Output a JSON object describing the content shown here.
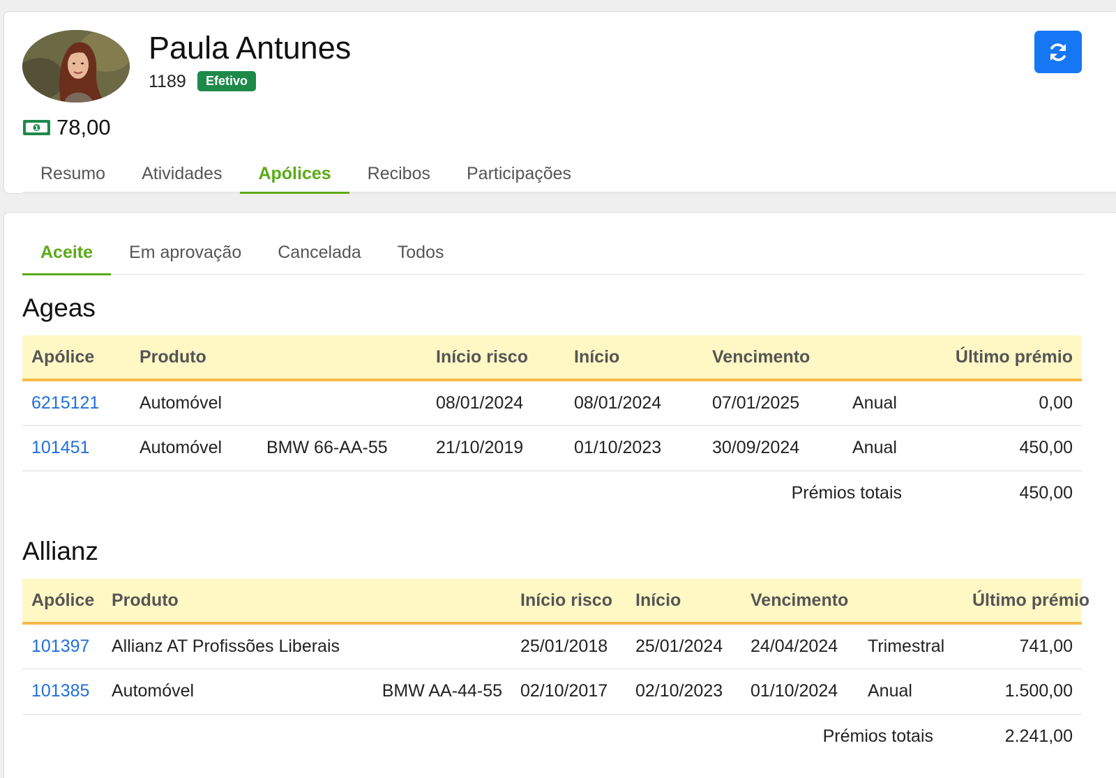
{
  "client": {
    "name": "Paula Antunes",
    "id": "1189",
    "status": "Efetivo",
    "balance": "78,00"
  },
  "main_tabs": [
    {
      "label": "Resumo",
      "active": false
    },
    {
      "label": "Atividades",
      "active": false
    },
    {
      "label": "Apólices",
      "active": true
    },
    {
      "label": "Recibos",
      "active": false
    },
    {
      "label": "Participações",
      "active": false
    }
  ],
  "sub_tabs": [
    {
      "label": "Aceite",
      "active": true
    },
    {
      "label": "Em aprovação",
      "active": false
    },
    {
      "label": "Cancelada",
      "active": false
    },
    {
      "label": "Todos",
      "active": false
    }
  ],
  "columns": {
    "policy": "Apólice",
    "product": "Produto",
    "risk_start": "Início risco",
    "start": "Início",
    "due": "Vencimento",
    "last_premium": "Último prémio"
  },
  "total_label": "Prémios totais",
  "groups": [
    {
      "insurer": "Ageas",
      "rows": [
        {
          "policy": "6215121",
          "product": "Automóvel",
          "object": "",
          "risk_start": "08/01/2024",
          "start": "08/01/2024",
          "due": "07/01/2025",
          "frequency": "Anual",
          "premium": "0,00"
        },
        {
          "policy": "101451",
          "product": "Automóvel",
          "object": "BMW 66-AA-55",
          "risk_start": "21/10/2019",
          "start": "01/10/2023",
          "due": "30/09/2024",
          "frequency": "Anual",
          "premium": "450,00"
        }
      ],
      "total": "450,00"
    },
    {
      "insurer": "Allianz",
      "rows": [
        {
          "policy": "101397",
          "product": "Allianz AT Profissões Liberais",
          "object": "",
          "risk_start": "25/01/2018",
          "start": "25/01/2024",
          "due": "24/04/2024",
          "frequency": "Trimestral",
          "premium": "741,00"
        },
        {
          "policy": "101385",
          "product": "Automóvel",
          "object": "BMW AA-44-55",
          "risk_start": "02/10/2017",
          "start": "02/10/2023",
          "due": "01/10/2024",
          "frequency": "Anual",
          "premium": "1.500,00"
        }
      ],
      "total": "2.241,00"
    }
  ],
  "icons": {
    "refresh": "refresh-icon",
    "money": "money-icon"
  },
  "colors": {
    "accent_green": "#5aaa16",
    "badge_green": "#1e8a4a",
    "link_blue": "#1f6fdc",
    "button_blue": "#1677f5",
    "header_yellow": "#fff8c5",
    "header_border": "#f6b949"
  }
}
